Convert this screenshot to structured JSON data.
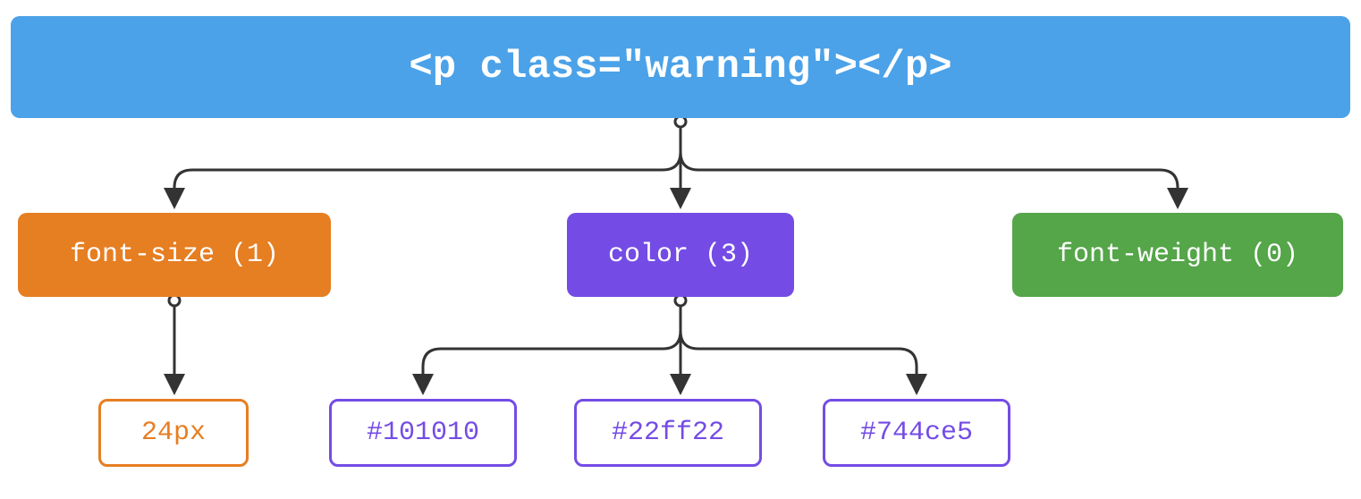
{
  "root": {
    "code": "<p class=\"warning\"></p>"
  },
  "properties": {
    "fontSize": {
      "label": "font-size (1)"
    },
    "color": {
      "label": "color (3)"
    },
    "fontWeight": {
      "label": "font-weight (0)"
    }
  },
  "values": {
    "fontSize": [
      "24px"
    ],
    "color": [
      "#101010",
      "#22ff22",
      "#744ce5"
    ]
  },
  "colors": {
    "root": "#4ba2e8",
    "orange": "#e67e22",
    "purple": "#744ce5",
    "green": "#55a549",
    "arrow": "#333333"
  }
}
